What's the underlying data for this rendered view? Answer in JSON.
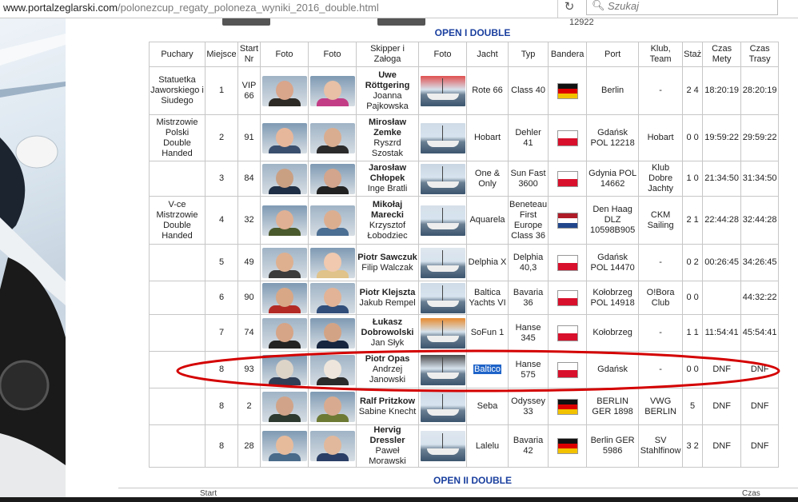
{
  "browser": {
    "url_bold": "www.portalzeglarski.com",
    "url_rest": "/polonezcup_regaty_poloneza_wyniki_2016_double.html",
    "search_placeholder": "Szukaj",
    "reload_icon": "reload-icon",
    "search_icon": "magnifier-icon"
  },
  "partial_row_above": {
    "value": "12922"
  },
  "section": {
    "title": "OPEN I DOUBLE",
    "next_title": "OPEN II DOUBLE",
    "next_partial_labels": [
      "Start",
      "Czas"
    ]
  },
  "columns": [
    "Puchary",
    "Miejsce",
    "Start Nr",
    "Foto",
    "Foto",
    "Skipper i Załoga",
    "Foto",
    "Jacht",
    "Typ",
    "Bandera",
    "Port",
    "Klub, Team",
    "Staż",
    "Czas Mety",
    "Czas Trasy"
  ],
  "rows": [
    {
      "puchar": "Statuetka Jaworskiego i Siudego",
      "miejsce": "1",
      "start": "VIP 66",
      "skipper": "Uwe Röttgering",
      "zaloga": "Joanna Pajkowska",
      "jacht": "Rote 66",
      "typ": "Class 40",
      "flag": "de",
      "port": "Berlin",
      "klub": "-",
      "staz": "2 4",
      "meta": "18:20:19",
      "trasa": "28:20:19"
    },
    {
      "puchar": "Mistrzowie Polski Double Handed",
      "miejsce": "2",
      "start": "91",
      "skipper": "Mirosław Zemke",
      "zaloga": "Ryszrd Szostak",
      "jacht": "Hobart",
      "typ": "Dehler 41",
      "flag": "pl",
      "port": "Gdańsk POL 12218",
      "klub": "Hobart",
      "staz": "0 0",
      "meta": "19:59:22",
      "trasa": "29:59:22"
    },
    {
      "puchar": "",
      "miejsce": "3",
      "start": "84",
      "skipper": "Jarosław Chłopek",
      "zaloga": "Inge Bratli",
      "jacht": "One & Only",
      "typ": "Sun Fast 3600",
      "flag": "pl",
      "port": "Gdynia POL 14662",
      "klub": "Klub Dobre Jachty",
      "staz": "1 0",
      "meta": "21:34:50",
      "trasa": "31:34:50"
    },
    {
      "puchar": "V-ce Mistrzowie Double Handed",
      "miejsce": "4",
      "start": "32",
      "skipper": "Mikołaj Marecki",
      "zaloga": "Krzysztof Łobodziec",
      "jacht": "Aquarela",
      "typ": "Beneteau First Europe Class 36",
      "flag": "nl",
      "port": "Den Haag DLZ 10598B905",
      "klub": "CKM Sailing",
      "staz": "2 1",
      "meta": "22:44:28",
      "trasa": "32:44:28"
    },
    {
      "puchar": "",
      "miejsce": "5",
      "start": "49",
      "skipper": "Piotr Sawczuk",
      "zaloga": "Filip Walczak",
      "jacht": "Delphia X",
      "typ": "Delphia 40,3",
      "flag": "pl",
      "port": "Gdańsk POL 14470",
      "klub": "-",
      "staz": "0 2",
      "meta": "00:26:45",
      "trasa": "34:26:45"
    },
    {
      "puchar": "",
      "miejsce": "6",
      "start": "90",
      "skipper": "Piotr Klejszta",
      "zaloga": "Jakub Rempel",
      "jacht": "Baltica Yachts VI",
      "typ": "Bavaria 36",
      "flag": "pl",
      "port": "Kołobrzeg POL 14918",
      "klub": "O!Bora Club",
      "staz": "0 0",
      "meta": "",
      "trasa": "44:32:22"
    },
    {
      "puchar": "",
      "miejsce": "7",
      "start": "74",
      "skipper": "Łukasz Dobrowolski",
      "zaloga": "Jan Słyk",
      "jacht": "SoFun 1",
      "typ": "Hanse 345",
      "flag": "pl",
      "port": "Kołobrzeg",
      "klub": "-",
      "staz": "1 1",
      "meta": "11:54:41",
      "trasa": "45:54:41"
    },
    {
      "puchar": "",
      "miejsce": "8",
      "start": "93",
      "skipper": "Piotr Opas",
      "zaloga": "Andrzej Janowski",
      "jacht": "Baltico",
      "typ": "Hanse 575",
      "flag": "pl",
      "port": "Gdańsk",
      "klub": "-",
      "staz": "0 0",
      "meta": "DNF",
      "trasa": "DNF",
      "highlight": true
    },
    {
      "puchar": "",
      "miejsce": "8",
      "start": "2",
      "skipper": "Ralf Pritzkow",
      "zaloga": "Sabine Knecht",
      "jacht": "Seba",
      "typ": "Odyssey 33",
      "flag": "de",
      "port": "BERLIN GER 1898",
      "klub": "VWG BERLIN",
      "staz": "5",
      "meta": "DNF",
      "trasa": "DNF"
    },
    {
      "puchar": "",
      "miejsce": "8",
      "start": "28",
      "skipper": "Hervig Dressler",
      "zaloga": "Paweł Morawski",
      "jacht": "Lalelu",
      "typ": "Bavaria 42",
      "flag": "de",
      "port": "Berlin GER 5986",
      "klub": "SV Stahlfinow",
      "staz": "3 2",
      "meta": "DNF",
      "trasa": "DNF"
    }
  ],
  "colors": {
    "section_title": "#1a3f9e",
    "annotation": "#d40000",
    "selection": "#1e63c8"
  }
}
